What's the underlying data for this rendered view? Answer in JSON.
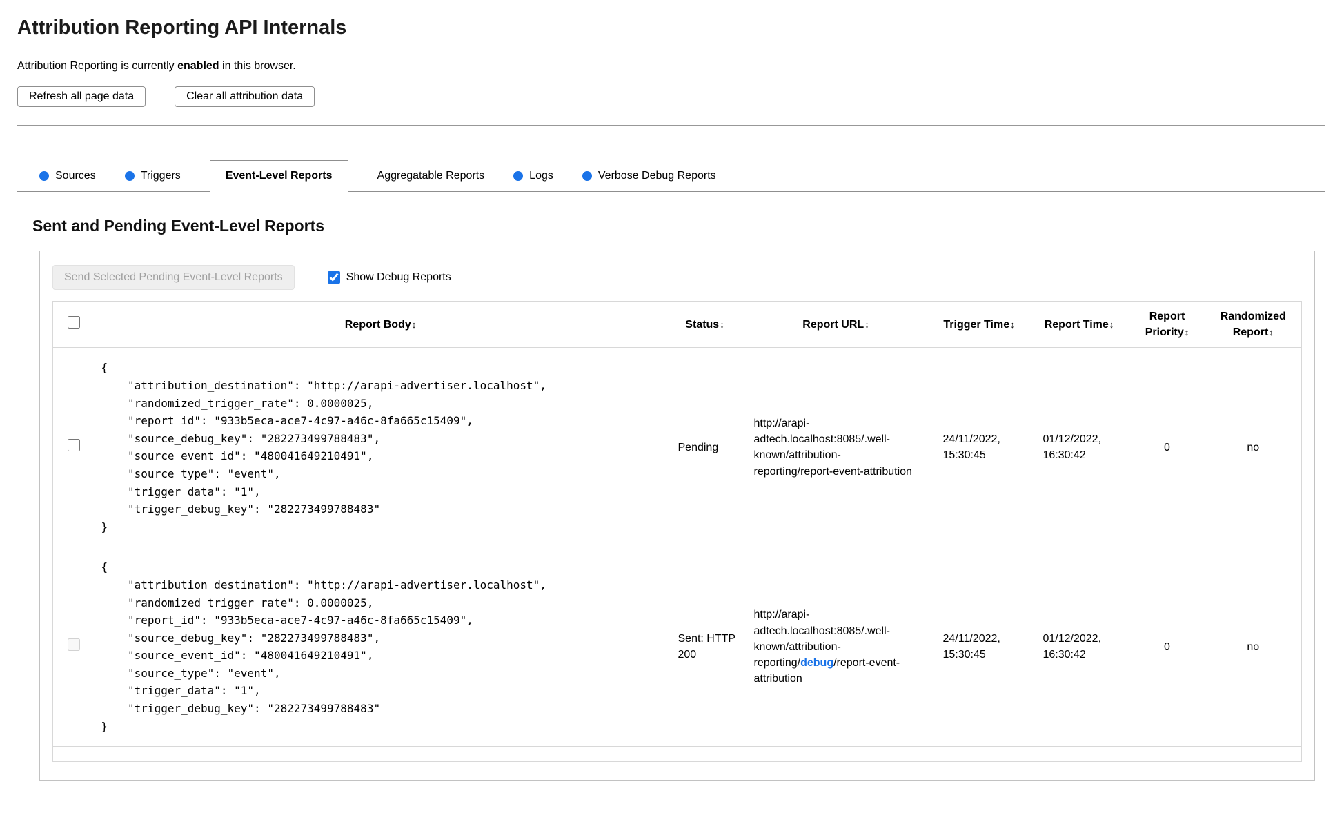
{
  "header": {
    "title": "Attribution Reporting API Internals",
    "status": {
      "prefix": "Attribution Reporting is currently ",
      "bold": "enabled",
      "suffix": " in this browser."
    },
    "buttons": {
      "refresh": "Refresh all page data",
      "clear": "Clear all attribution data"
    }
  },
  "tabs": {
    "items": [
      {
        "label": "Sources"
      },
      {
        "label": "Triggers"
      },
      {
        "label": "Event-Level Reports"
      },
      {
        "label": "Aggregatable Reports"
      },
      {
        "label": "Logs"
      },
      {
        "label": "Verbose Debug Reports"
      }
    ]
  },
  "section": {
    "heading": "Sent and Pending Event-Level Reports"
  },
  "panel": {
    "send_button": "Send Selected Pending Event-Level Reports",
    "show_debug_label": "Show Debug Reports",
    "show_debug_checked": "checked",
    "sort_icon": "↕",
    "accent_color": "#1a73e8"
  },
  "table": {
    "headers": {
      "report_body": "Report Body",
      "status": "Status",
      "report_url": "Report URL",
      "trigger_time": "Trigger Time",
      "report_time": "Report Time",
      "report_priority": "Report Priority",
      "randomized_report": "Randomized Report"
    },
    "rows": [
      {
        "report_body": "{\n    \"attribution_destination\": \"http://arapi-advertiser.localhost\",\n    \"randomized_trigger_rate\": 0.0000025,\n    \"report_id\": \"933b5eca-ace7-4c97-a46c-8fa665c15409\",\n    \"source_debug_key\": \"282273499788483\",\n    \"source_event_id\": \"480041649210491\",\n    \"source_type\": \"event\",\n    \"trigger_data\": \"1\",\n    \"trigger_debug_key\": \"282273499788483\"\n}",
        "status": "Pending",
        "url_pre": "http://arapi-adtech.localhost:8085/.well-known/attribution-reporting/report-event-attribution",
        "url_debug": "",
        "url_post": "",
        "trigger_time": "24/11/2022, 15:30:45",
        "report_time": "01/12/2022, 16:30:42",
        "report_priority": "0",
        "randomized_report": "no"
      },
      {
        "report_body": "{\n    \"attribution_destination\": \"http://arapi-advertiser.localhost\",\n    \"randomized_trigger_rate\": 0.0000025,\n    \"report_id\": \"933b5eca-ace7-4c97-a46c-8fa665c15409\",\n    \"source_debug_key\": \"282273499788483\",\n    \"source_event_id\": \"480041649210491\",\n    \"source_type\": \"event\",\n    \"trigger_data\": \"1\",\n    \"trigger_debug_key\": \"282273499788483\"\n}",
        "status": "Sent: HTTP 200",
        "url_pre": "http://arapi-adtech.localhost:8085/.well-known/attribution-reporting/",
        "url_debug": "debug",
        "url_post": "/report-event-attribution",
        "trigger_time": "24/11/2022, 15:30:45",
        "report_time": "01/12/2022, 16:30:42",
        "report_priority": "0",
        "randomized_report": "no"
      }
    ]
  }
}
